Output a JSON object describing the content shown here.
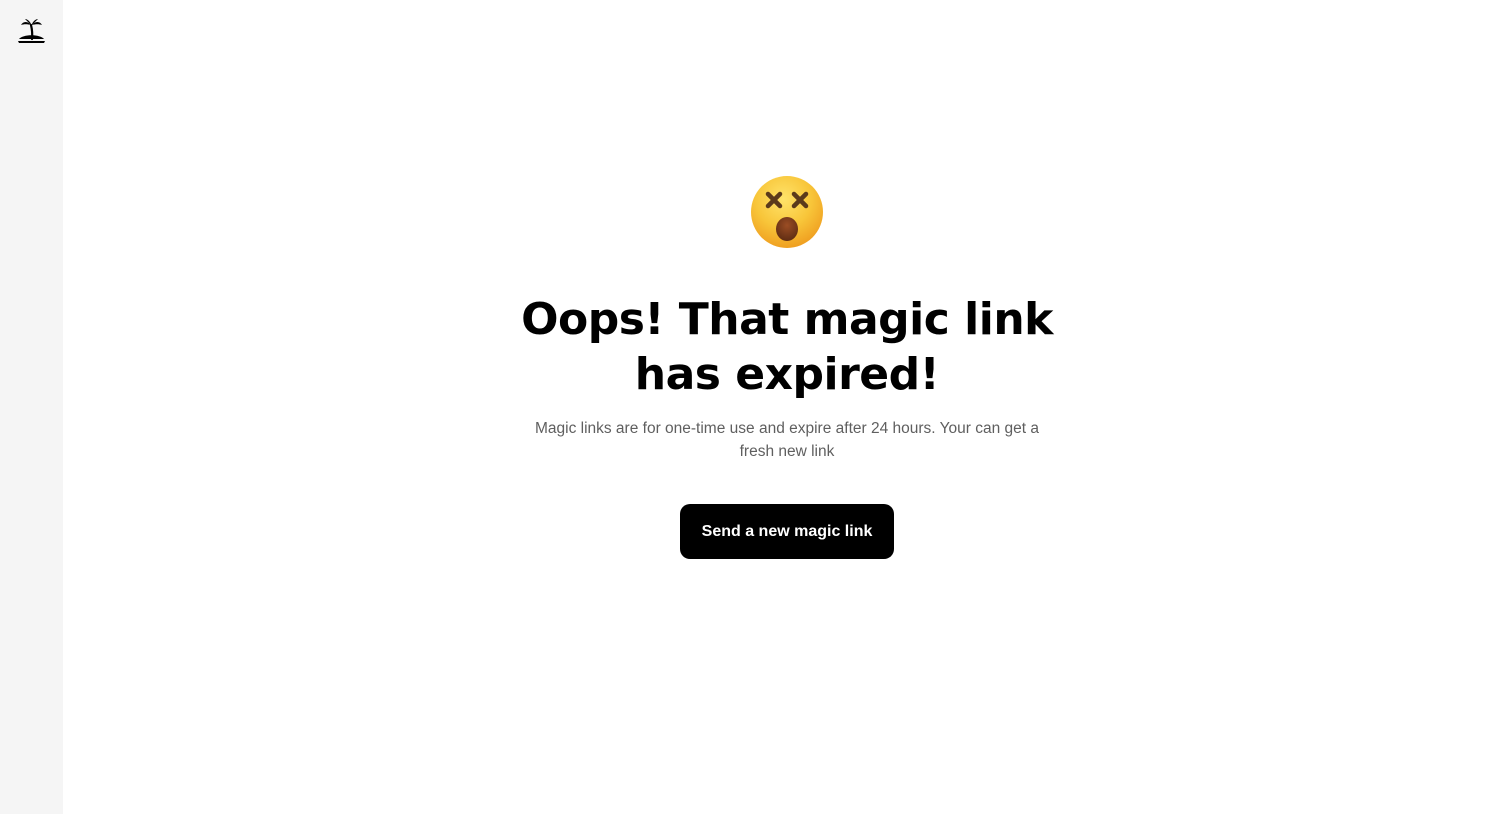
{
  "sidebar": {
    "logo_icon": "palm-tree-island-icon"
  },
  "main": {
    "status_emoji_icon": "dizzy-face-emoji-icon",
    "headline_line1": "Oops! That magic link",
    "headline_line2": "has expired!",
    "description": "Magic links are for one-time use and expire after 24 hours. Your can get a fresh new link",
    "cta_label": "Send a new magic link"
  },
  "colors": {
    "sidebar_bg": "#f5f5f5",
    "page_bg": "#ffffff",
    "text_primary": "#000000",
    "text_secondary": "#5f5f5f",
    "button_bg": "#000000",
    "button_text": "#ffffff",
    "emoji_yellow": "#f7b72b"
  }
}
